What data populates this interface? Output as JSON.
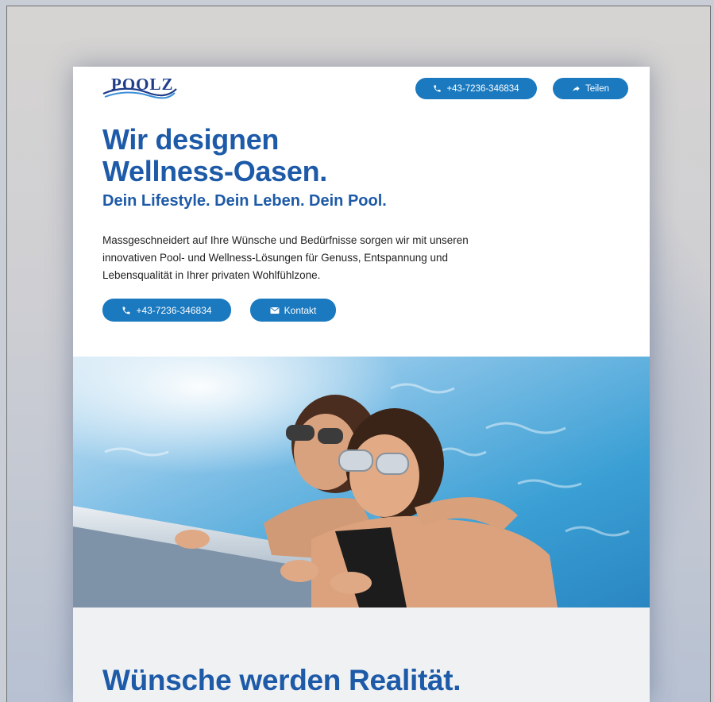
{
  "brand": {
    "logo_text": "POOLZ"
  },
  "header": {
    "phone_label": "+43-7236-346834",
    "share_label": "Teilen"
  },
  "hero": {
    "title_line1": "Wir designen",
    "title_line2": "Wellness-Oasen.",
    "subtitle": "Dein Lifestyle. Dein Leben. Dein Pool.",
    "body": "Massgeschneidert auf Ihre Wünsche und Bedürfnisse sorgen wir mit unseren innovativen Pool- und Wellness-Lösungen für Genuss, Entspannung und Lebensqualität in Ihrer privaten Wohlfühlzone.",
    "phone_label": "+43-7236-346834",
    "contact_label": "Kontakt"
  },
  "section2": {
    "title": "Wünsche werden Realität."
  },
  "icons": {
    "phone": "phone-icon",
    "share": "share-arrow-icon",
    "mail": "envelope-icon"
  },
  "colors": {
    "accent": "#1a79bf",
    "heading": "#1d5aa8",
    "logo": "#1f3d8a",
    "section_bg": "#f0f1f3"
  }
}
